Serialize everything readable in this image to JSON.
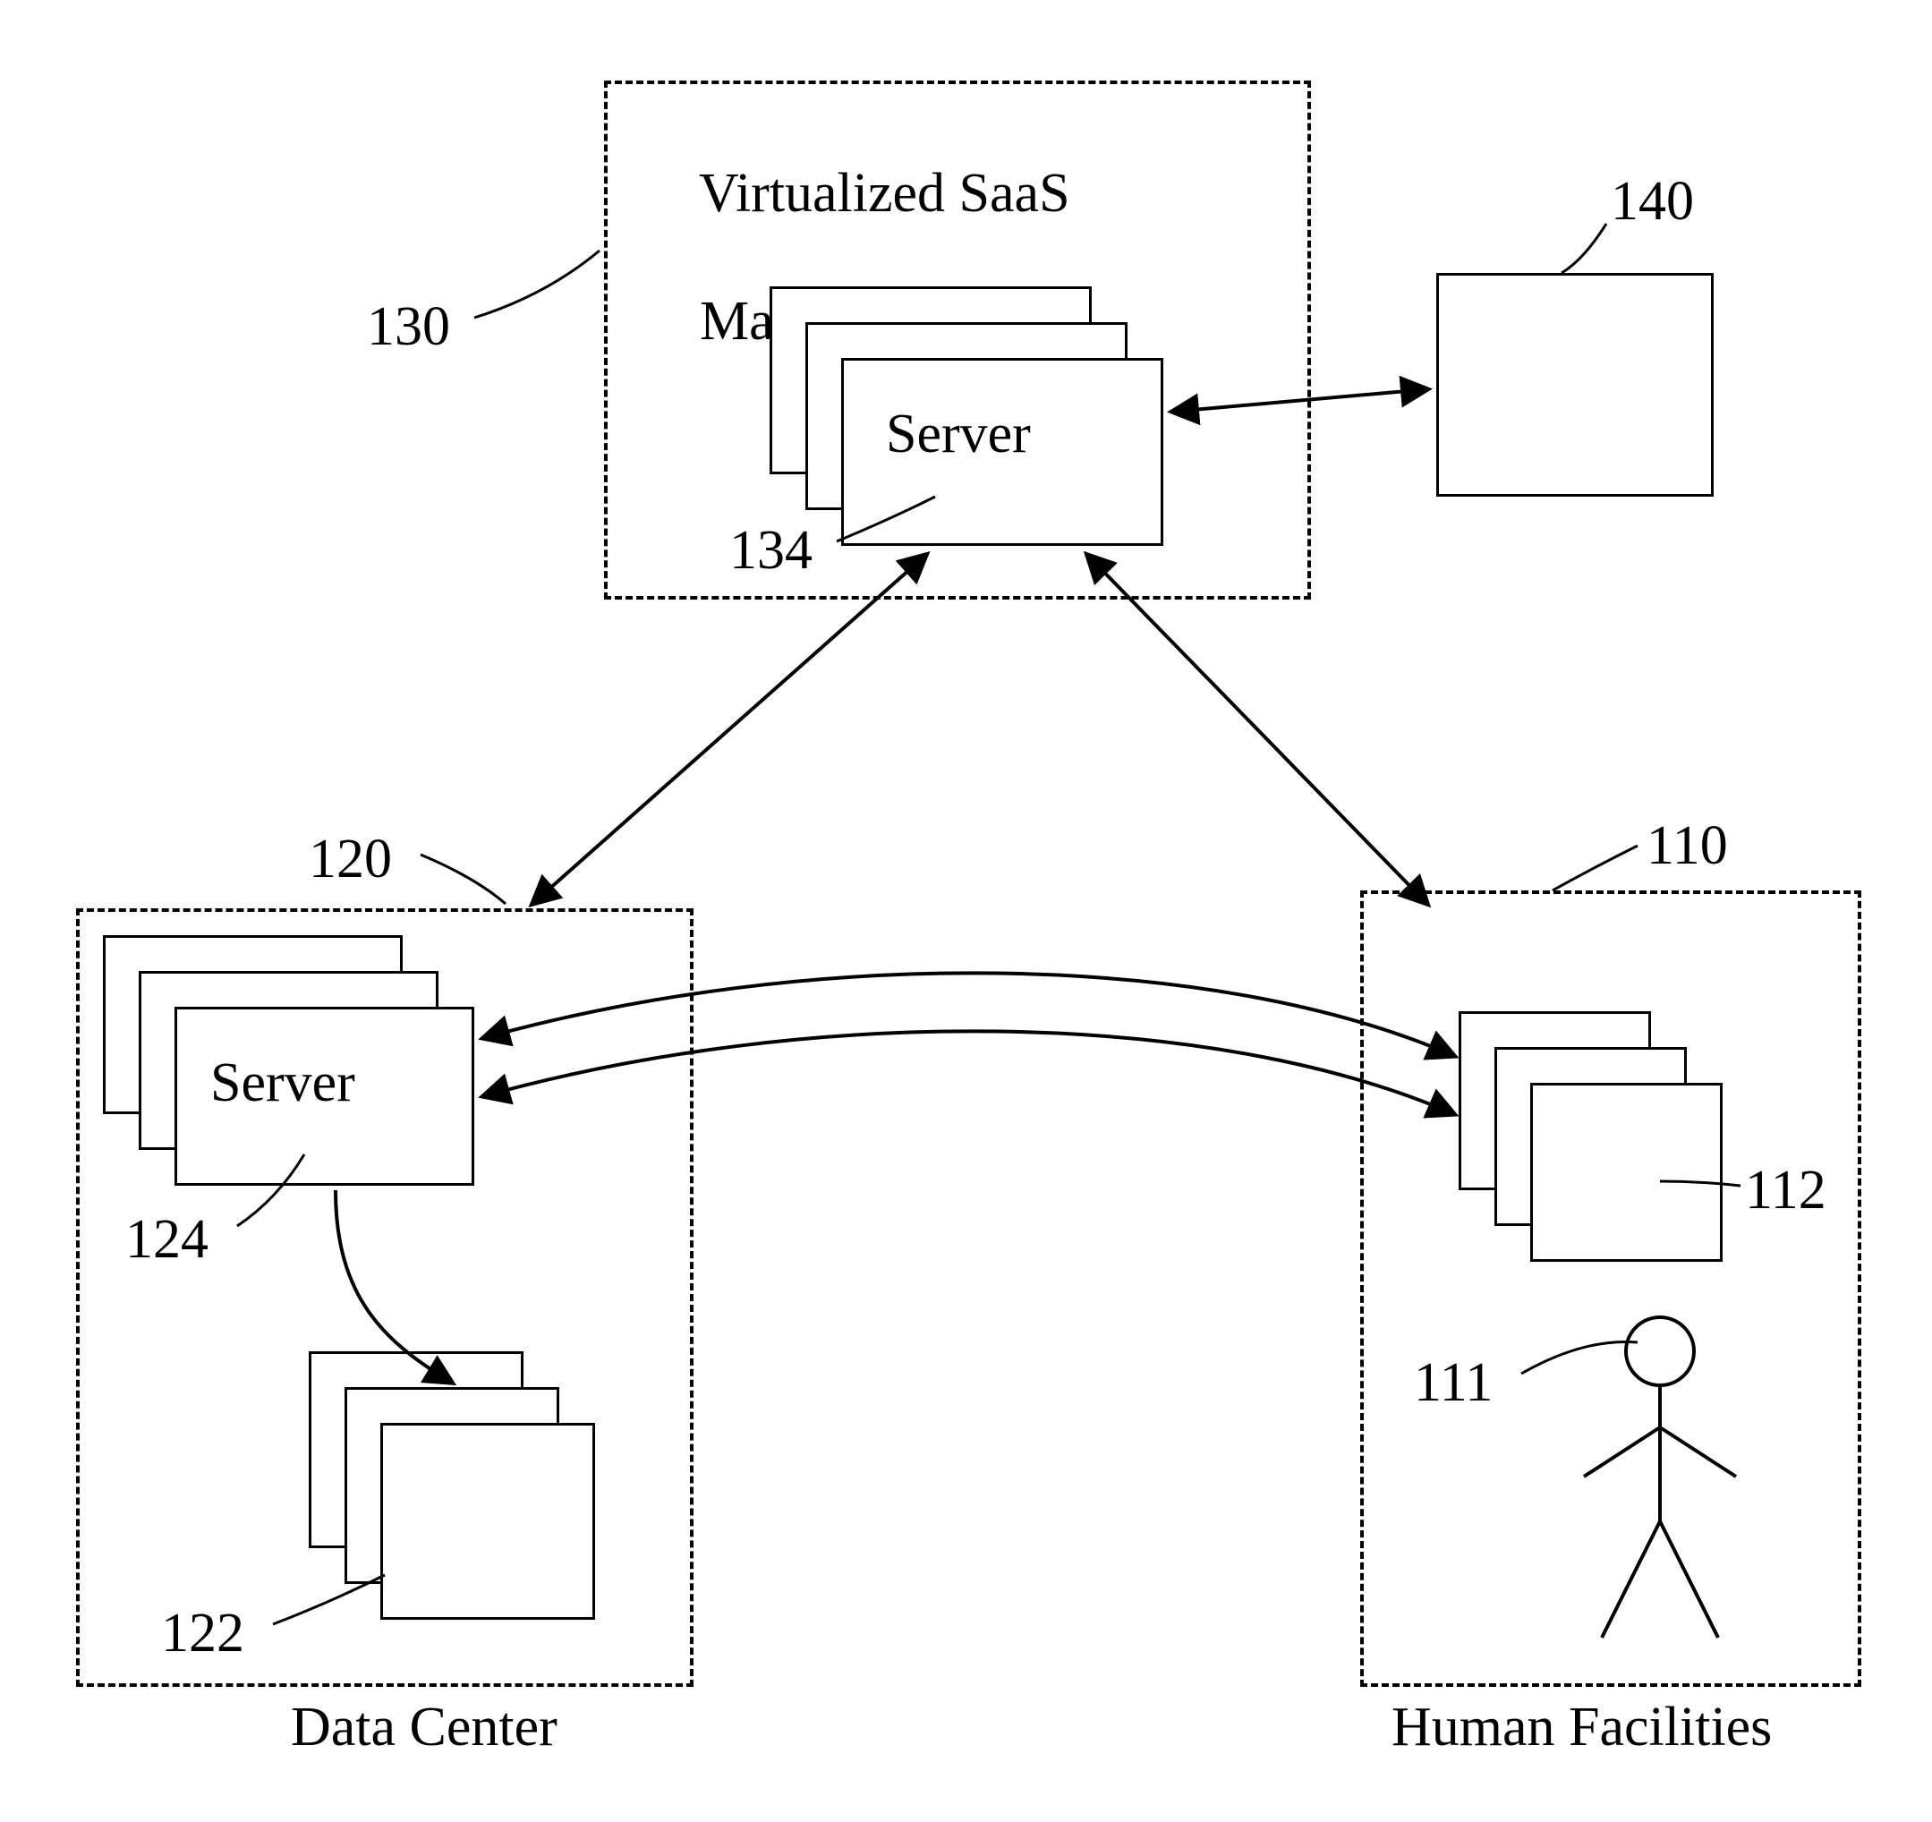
{
  "diagram": {
    "top": {
      "title_line1": "Virtualized SaaS",
      "title_line2": "Management",
      "ref": "130",
      "server_label": "Server",
      "server_ref": "134"
    },
    "right_top_box_ref": "140",
    "left": {
      "ref": "120",
      "server_label": "Server",
      "server_ref": "124",
      "stack_ref": "122",
      "caption": "Data Center"
    },
    "right": {
      "ref": "110",
      "stack_ref": "112",
      "person_ref": "111",
      "caption": "Human Facilities"
    }
  }
}
